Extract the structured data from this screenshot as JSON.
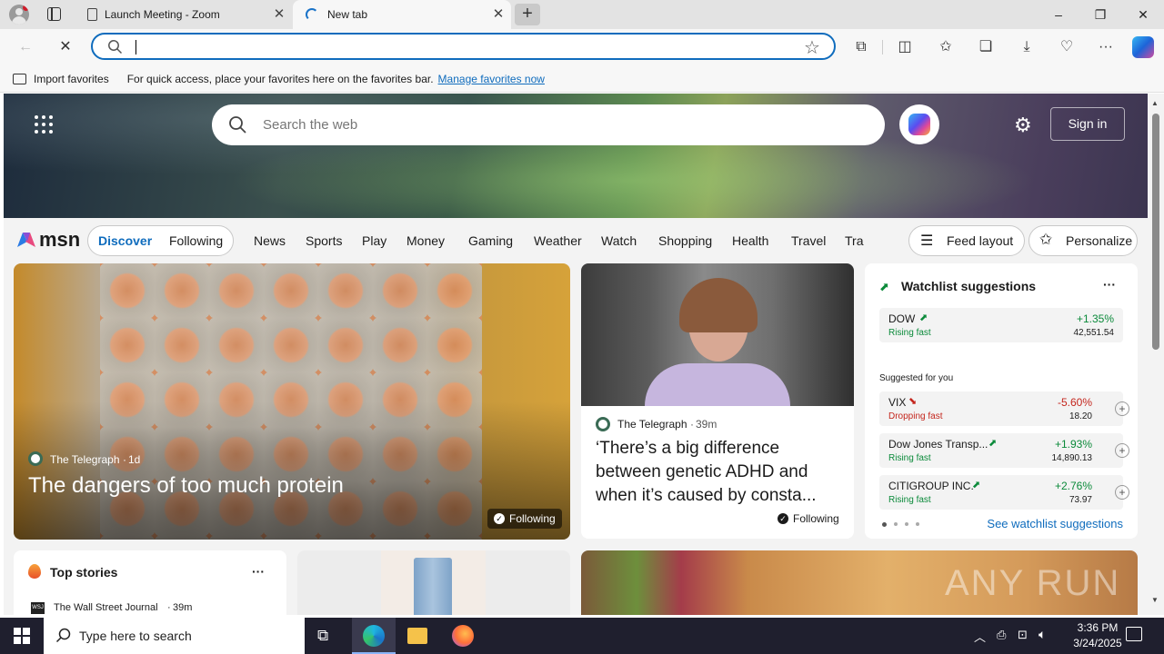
{
  "tabs": [
    {
      "title": "Launch Meeting - Zoom",
      "icon": "document-icon"
    },
    {
      "title": "New tab",
      "icon": "edge-loading-icon"
    }
  ],
  "window": {
    "minimize": "–",
    "restore": "❐",
    "close": "✕"
  },
  "address_bar": {
    "value": "",
    "placeholder": ""
  },
  "favorites_bar": {
    "import_label": "Import favorites",
    "message": "For quick access, place your favorites here on the favorites bar.",
    "manage_link": "Manage favorites now"
  },
  "msn": {
    "search_placeholder": "Search the web",
    "sign_in": "Sign in",
    "logo_text": "msn",
    "discover": "Discover",
    "following": "Following",
    "nav_items": [
      "News",
      "Sports",
      "Play",
      "Money",
      "Gaming",
      "Weather",
      "Watch",
      "Shopping",
      "Health",
      "Travel",
      "Tra"
    ],
    "feed_layout": "Feed layout",
    "personalize": "Personalize"
  },
  "hero_story": {
    "source": "The Telegraph",
    "age": "1d",
    "headline": "The dangers of too much protein",
    "following": "Following"
  },
  "story2": {
    "source": "The Telegraph",
    "age": "39m",
    "headline": "‘There’s a big difference between genetic ADHD and when it’s caused by consta...",
    "following": "Following"
  },
  "watchlist": {
    "title": "Watchlist suggestions",
    "menu": "···",
    "suggested_label": "Suggested for you",
    "see_more": "See watchlist suggestions",
    "items": [
      {
        "name": "DOW",
        "status": "Rising fast",
        "change": "+1.35%",
        "price": "42,551.54",
        "color": "#0b8a3a"
      },
      {
        "name": "VIX",
        "status": "Dropping fast",
        "change": "-5.60%",
        "price": "18.20",
        "color": "#c4261d"
      },
      {
        "name": "Dow Jones Transp...",
        "status": "Rising fast",
        "change": "+1.93%",
        "price": "14,890.13",
        "color": "#0b8a3a"
      },
      {
        "name": "CITIGROUP INC.",
        "status": "Rising fast",
        "change": "+2.76%",
        "price": "73.97",
        "color": "#0b8a3a"
      }
    ]
  },
  "top_stories": {
    "title": "Top stories",
    "menu": "···",
    "first_source": "The Wall Street Journal",
    "first_age": "39m",
    "source_badge": "WSJ"
  },
  "watermark": "ANY RUN",
  "taskbar": {
    "search_placeholder": "Type here to search",
    "time": "3:36 PM",
    "date": "3/24/2025"
  },
  "colors": {
    "accent": "#0f6cbd",
    "rise": "#0b8a3a",
    "drop": "#c4261d"
  }
}
